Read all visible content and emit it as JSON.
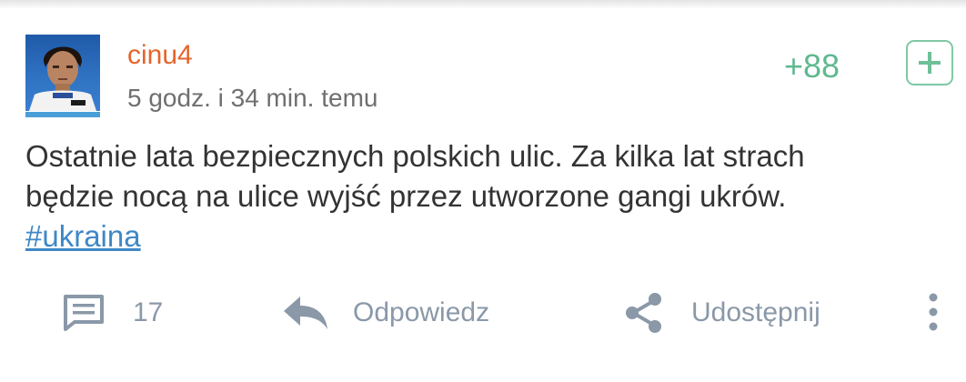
{
  "post": {
    "username": "cinu4",
    "timestamp": "5 godz. i 34 min. temu",
    "score": "+88",
    "text_lines": [
      "Ostatnie lata bezpiecznych polskich ulic. Za kilka lat strach",
      "będzie nocą na ulice wyjść przez utworzone gangi ukrów."
    ],
    "hashtag": "#ukraina"
  },
  "actions": {
    "comments_count": "17",
    "reply_label": "Odpowiedz",
    "share_label": "Udostępnij"
  },
  "icons": {
    "plus": "plus-icon",
    "comments": "comment-icon",
    "reply": "reply-icon",
    "share": "share-icon",
    "more": "more-vertical-icon"
  },
  "colors": {
    "username": "#e5642b",
    "score": "#5fb98f",
    "hashtag": "#3f87c6",
    "action_gray": "#8a98a8"
  }
}
